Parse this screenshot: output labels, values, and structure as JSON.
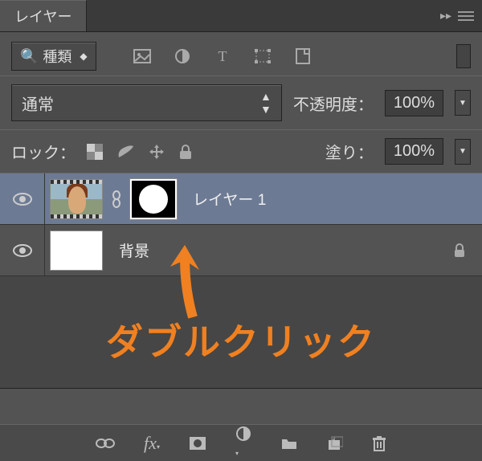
{
  "panel": {
    "title": "レイヤー"
  },
  "filter": {
    "label": "種類"
  },
  "blend": {
    "mode": "通常",
    "opacity_label": "不透明度：",
    "opacity_value": "100%"
  },
  "lock": {
    "label": "ロック：",
    "fill_label": "塗り：",
    "fill_value": "100%"
  },
  "layers": [
    {
      "name": "レイヤー 1"
    },
    {
      "name": "背景"
    }
  ],
  "annotation": {
    "text": "ダブルクリック"
  }
}
